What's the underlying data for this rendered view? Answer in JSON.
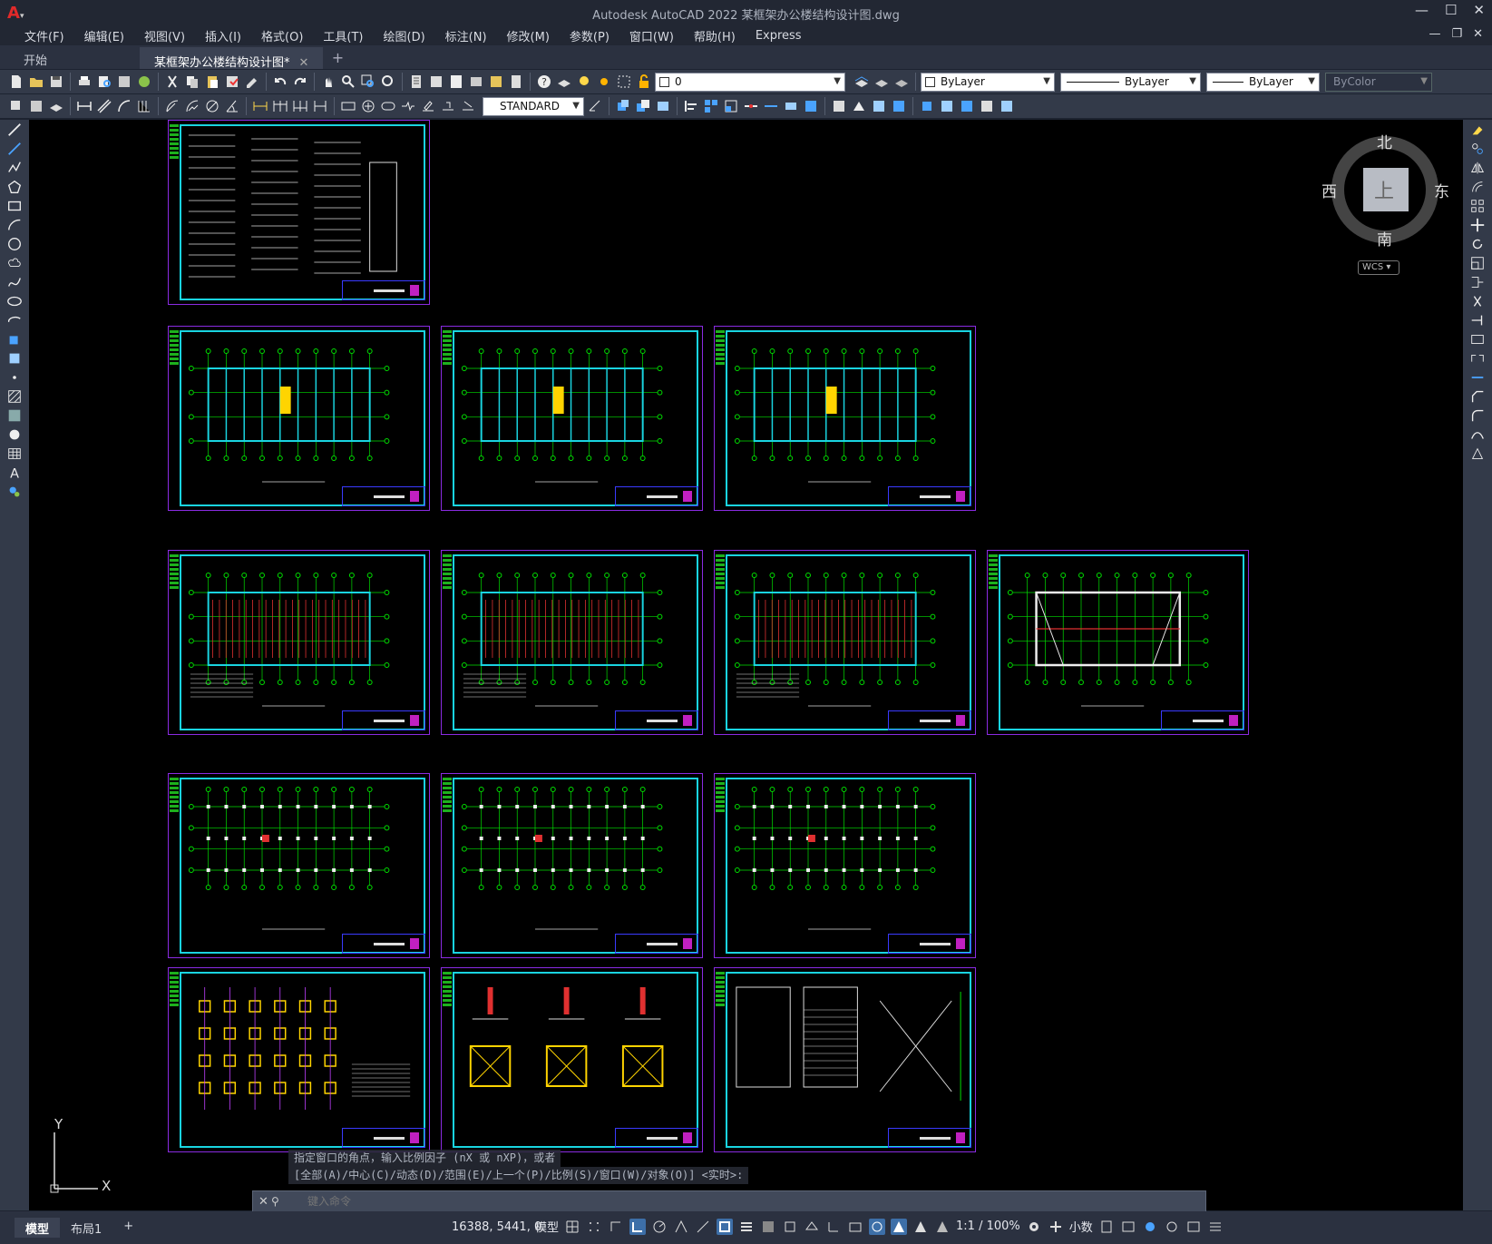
{
  "window": {
    "title": "Autodesk AutoCAD 2022    某框架办公楼结构设计图.dwg",
    "min": "—",
    "max": "☐",
    "close": "✕"
  },
  "menu": [
    "文件(F)",
    "编辑(E)",
    "视图(V)",
    "插入(I)",
    "格式(O)",
    "工具(T)",
    "绘图(D)",
    "标注(N)",
    "修改(M)",
    "参数(P)",
    "窗口(W)",
    "帮助(H)",
    "Express"
  ],
  "doc_controls": {
    "min": "—",
    "restore": "❐",
    "close": "✕"
  },
  "tabs": [
    {
      "label": "开始",
      "active": false
    },
    {
      "label": "某框架办公楼结构设计图*",
      "active": true,
      "close": "✕"
    }
  ],
  "tab_add": "+",
  "properties": {
    "layer": "0",
    "color": "ByLayer",
    "linetype": "ByLayer",
    "lineweight": "ByLayer",
    "plotstyle": "ByColor",
    "text_style": "STANDARD"
  },
  "viewcube": {
    "north": "北",
    "south": "南",
    "west": "西",
    "east": "东",
    "face": "上",
    "ucs": "WCS"
  },
  "ucs_icon": {
    "x": "X",
    "y": "Y"
  },
  "command": {
    "history1": "指定窗口的角点，输入比例因子 (nX 或 nXP)，或者",
    "history2": "[全部(A)/中心(C)/动态(D)/范围(E)/上一个(P)/比例(S)/窗口(W)/对象(O)] <实时>:",
    "placeholder": "键入命令"
  },
  "status": {
    "model_tab": "模型",
    "layout_tab": "布局1",
    "add": "+",
    "coords": "16388, 5441, 0",
    "model": "模型",
    "scale": "1:1 / 100%",
    "units": "小数"
  },
  "colors": {
    "canvas": "#000000",
    "sheet_border": "#8a2be2",
    "frame": "#19d4e0",
    "grid": "#00e000",
    "accent": "#ffd400",
    "rebar": "#e03030"
  }
}
